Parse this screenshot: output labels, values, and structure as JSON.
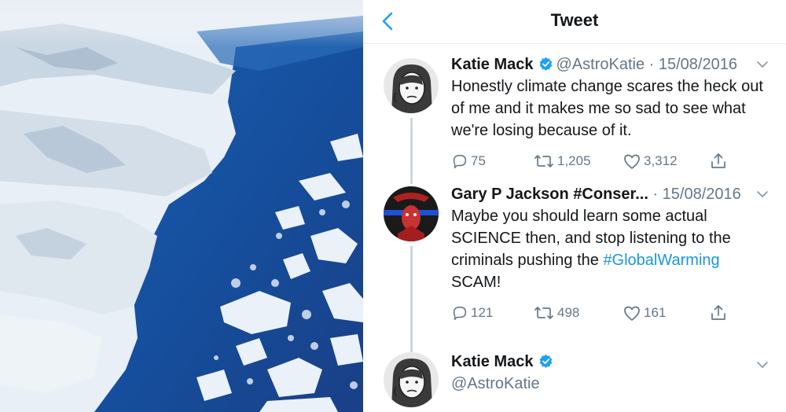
{
  "photo": {
    "alt": ""
  },
  "header": {
    "title": "Tweet",
    "back_icon": "chevron-left-icon"
  },
  "colors": {
    "accent": "#1da1f2",
    "link": "#1b95e0",
    "secondary_text": "#657786",
    "divider": "#e6ecf0"
  },
  "tweets": [
    {
      "name": "Katie Mack",
      "verified": true,
      "handle": "@AstroKatie",
      "date": "15/08/2016",
      "text": "Honestly climate change scares the heck out of me and it makes me so sad to see what we're losing because of it.",
      "replies": "75",
      "retweets": "1,205",
      "likes": "3,312"
    },
    {
      "name": "Gary P Jackson #Conser...",
      "verified": false,
      "handle": "",
      "date": "15/08/2016",
      "text_before": "Maybe you should learn some actual SCIENCE then, and stop listening to the criminals pushing the ",
      "hashtag": "#GlobalWarming",
      "text_after": " SCAM!",
      "replies": "121",
      "retweets": "498",
      "likes": "161"
    },
    {
      "name": "Katie Mack",
      "verified": true,
      "handle": "@AstroKatie"
    }
  ]
}
